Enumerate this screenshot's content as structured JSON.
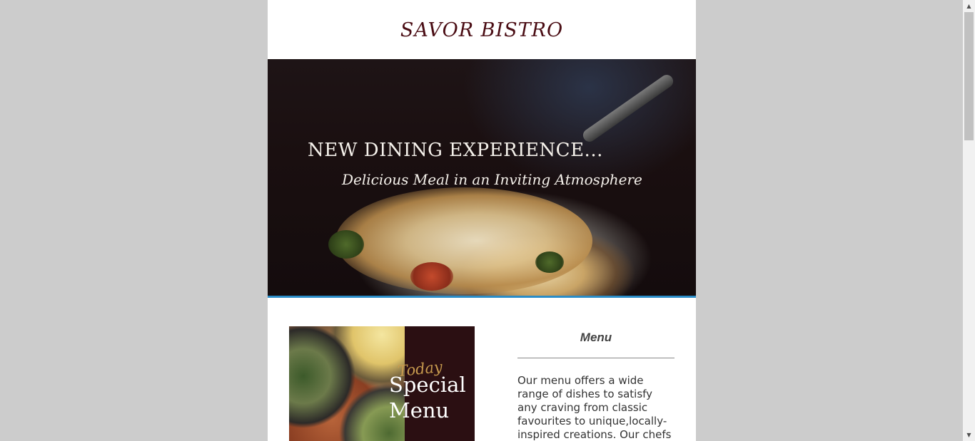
{
  "header": {
    "brand": "SAVOR BISTRO"
  },
  "hero": {
    "title": "NEW DINING EXPERIENCE...",
    "subtitle": "Delicious Meal in an Inviting Atmosphere"
  },
  "promo": {
    "script_word": "Today",
    "line1": "Special",
    "line2": "Menu"
  },
  "menu": {
    "heading": "Menu",
    "text": "Our menu offers a wide range of dishes to satisfy any craving from classic favourites to unique,locally-inspired creations. Our chefs ensure"
  },
  "scrollbar": {
    "up_icon": "triangle-up-icon",
    "down_icon": "triangle-down-icon"
  },
  "colors": {
    "background": "#cccccc",
    "brand": "#4a0d14",
    "hero_border": "#2a8cc7",
    "promo_bg": "#2b0f12"
  }
}
